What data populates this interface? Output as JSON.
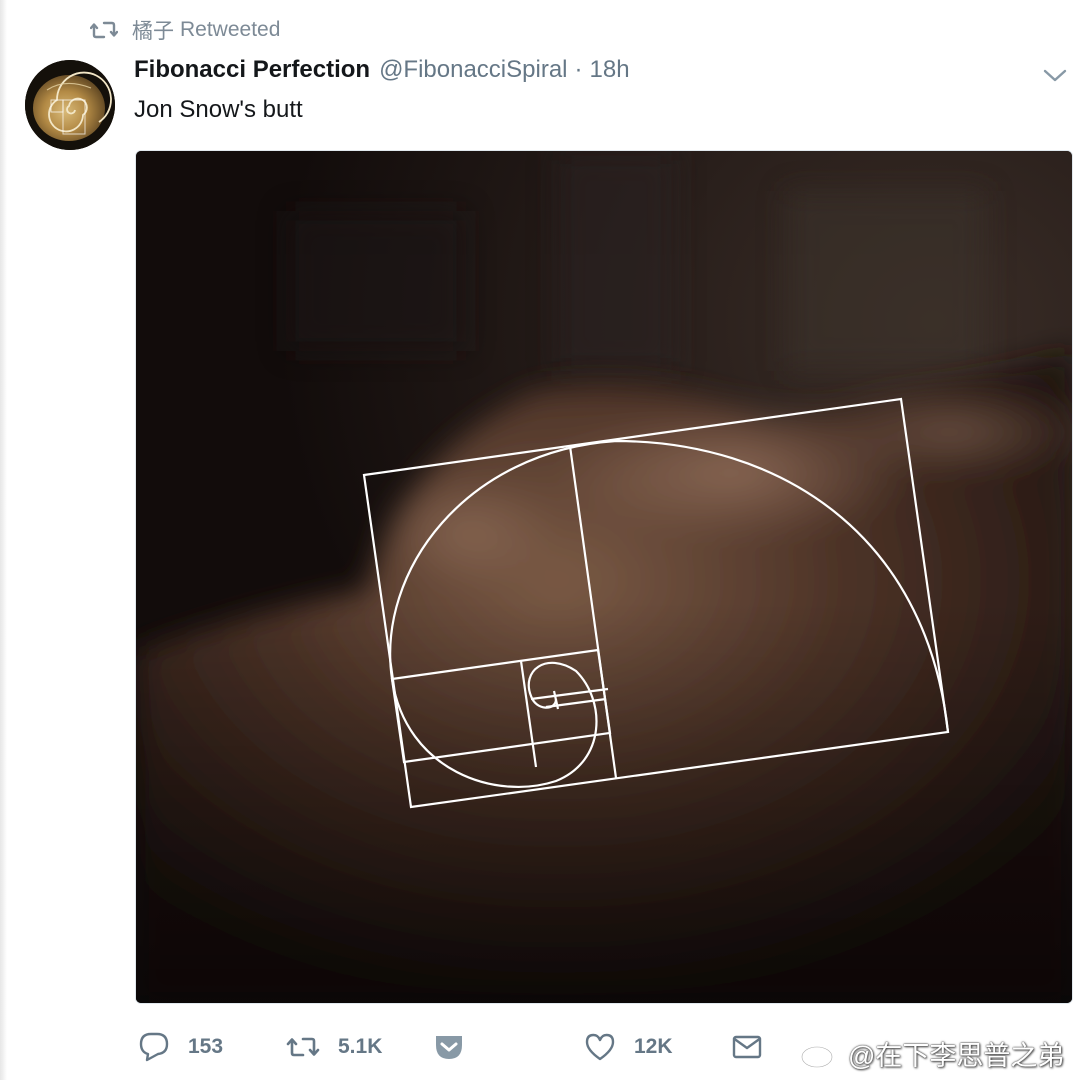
{
  "context": {
    "retweeter": "橘子",
    "action": "Retweeted",
    "icon": "retweet-icon"
  },
  "tweet": {
    "display_name": "Fibonacci Perfection",
    "handle": "@FibonacciSpiral",
    "separator": "·",
    "time": "18h",
    "text": "Jon Snow's butt",
    "avatar_icon": "nautilus-shell-avatar",
    "menu_icon": "chevron-down-icon",
    "media_icon": "photo-with-golden-spiral-overlay"
  },
  "actions": {
    "reply_count": "153",
    "retweet_count": "5.1K",
    "like_count": "12K",
    "icons": [
      "reply-icon",
      "retweet-icon",
      "pocket-icon",
      "like-icon",
      "message-icon"
    ]
  },
  "watermark": {
    "text": "@在下李思普之弟",
    "icon": "weibo-icon"
  },
  "colors": {
    "text_primary": "#14171a",
    "text_secondary": "#657786",
    "icon_gray": "#657786",
    "pocket_gray": "#8899a6"
  }
}
